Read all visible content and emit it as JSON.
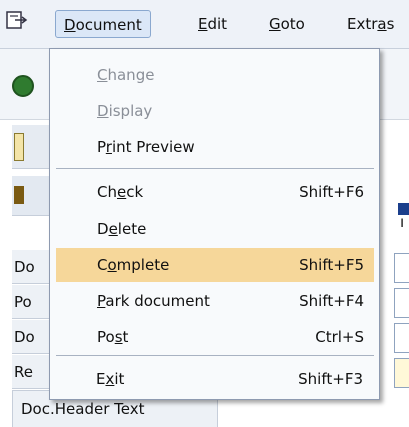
{
  "menubar": {
    "items": [
      {
        "pre": "",
        "ul": "D",
        "post": "ocument",
        "active": true
      },
      {
        "pre": "",
        "ul": "E",
        "post": "dit",
        "active": false
      },
      {
        "pre": "",
        "ul": "G",
        "post": "oto",
        "active": false
      },
      {
        "pre": "Extr",
        "ul": "a",
        "post": "s",
        "active": false
      }
    ]
  },
  "background": {
    "rows": [
      "Do",
      "Po",
      "Do",
      "Re"
    ],
    "doc_header_text": "Doc.Header Text"
  },
  "dropdown": {
    "items": [
      {
        "pre": "",
        "ul": "C",
        "post": "hange",
        "shortcut": "",
        "disabled": true
      },
      {
        "pre": "",
        "ul": "D",
        "post": "isplay",
        "shortcut": "",
        "disabled": true
      },
      {
        "pre": "P",
        "ul": "r",
        "post": "int Preview",
        "shortcut": "",
        "disabled": false
      },
      {
        "pre": "Ch",
        "ul": "e",
        "post": "ck",
        "shortcut": "Shift+F6",
        "disabled": false
      },
      {
        "pre": "D",
        "ul": "e",
        "post": "lete",
        "shortcut": "",
        "disabled": false
      },
      {
        "pre": "C",
        "ul": "o",
        "post": "mplete",
        "shortcut": "Shift+F5",
        "disabled": false,
        "highlighted": true
      },
      {
        "pre": "",
        "ul": "P",
        "post": "ark document",
        "shortcut": "Shift+F4",
        "disabled": false
      },
      {
        "pre": "Po",
        "ul": "s",
        "post": "t",
        "shortcut": "Ctrl+S",
        "disabled": false
      },
      {
        "pre": "E",
        "ul": "x",
        "post": "it",
        "shortcut": "Shift+F3",
        "disabled": false
      }
    ],
    "highlight_color": "#f6d79a"
  }
}
